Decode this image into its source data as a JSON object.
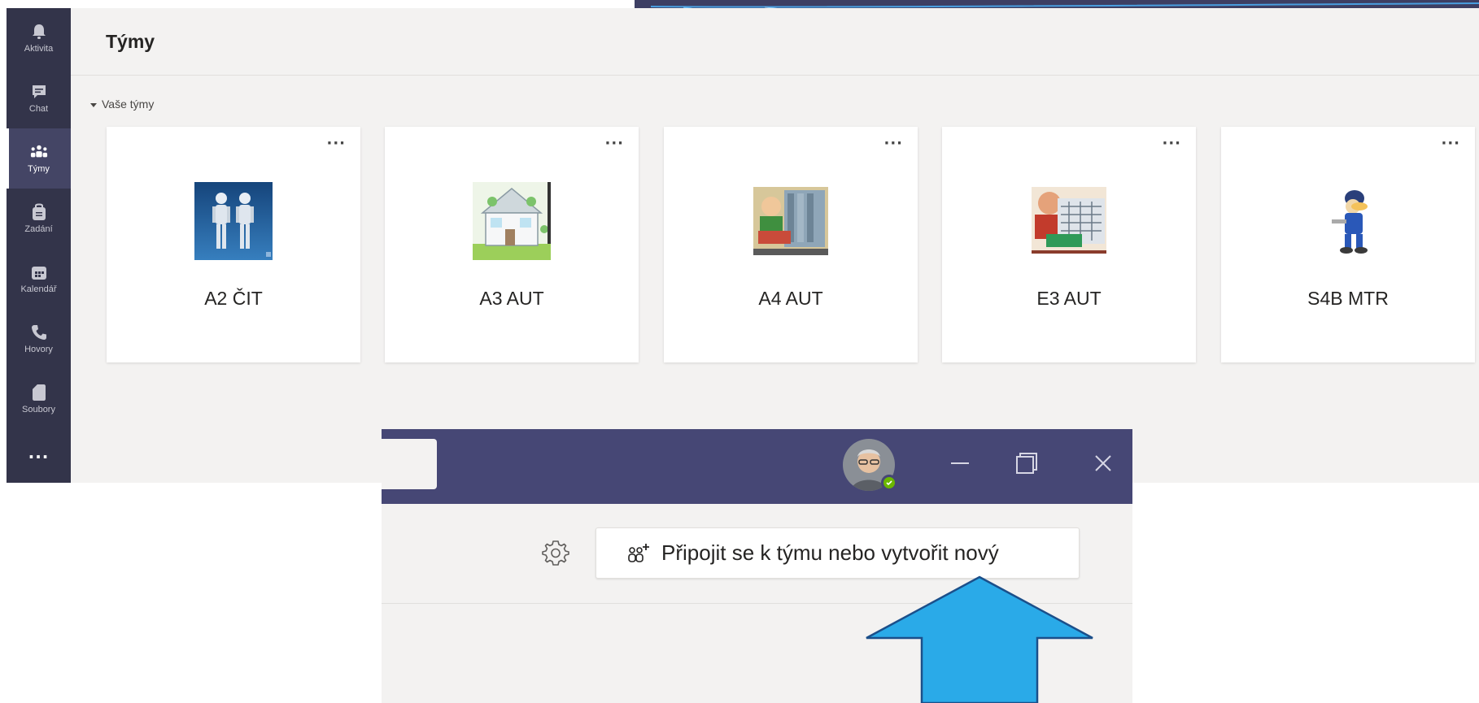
{
  "rail": {
    "items": [
      {
        "label": "Aktivita",
        "icon": "bell-icon"
      },
      {
        "label": "Chat",
        "icon": "chat-icon"
      },
      {
        "label": "Týmy",
        "icon": "teams-icon",
        "active": true
      },
      {
        "label": "Zadání",
        "icon": "assignments-icon"
      },
      {
        "label": "Kalendář",
        "icon": "calendar-icon"
      },
      {
        "label": "Hovory",
        "icon": "phone-icon"
      },
      {
        "label": "Soubory",
        "icon": "file-icon"
      }
    ],
    "more_label": "···"
  },
  "header": {
    "title": "Týmy"
  },
  "section": {
    "label": "Vaše týmy"
  },
  "teams": [
    {
      "name": "A2 ČIT",
      "image": "robots-image",
      "more": "···"
    },
    {
      "name": "A3 AUT",
      "image": "smart-home-image",
      "more": "···"
    },
    {
      "name": "A4 AUT",
      "image": "cartoon-engineer-image",
      "more": "···"
    },
    {
      "name": "E3 AUT",
      "image": "cartoon-technician-image",
      "more": "···"
    },
    {
      "name": "S4B MTR",
      "image": "cartoon-worker-image",
      "more": "···"
    }
  ],
  "window": {
    "minimize": "—",
    "maximize": "❐",
    "close": "✕",
    "join_button_label": "Připojit se k týmu nebo vytvořit nový"
  },
  "colors": {
    "rail": "#33344a",
    "titlebar": "#464775",
    "arrow": "#29abe2",
    "presence": "#6bb700"
  }
}
